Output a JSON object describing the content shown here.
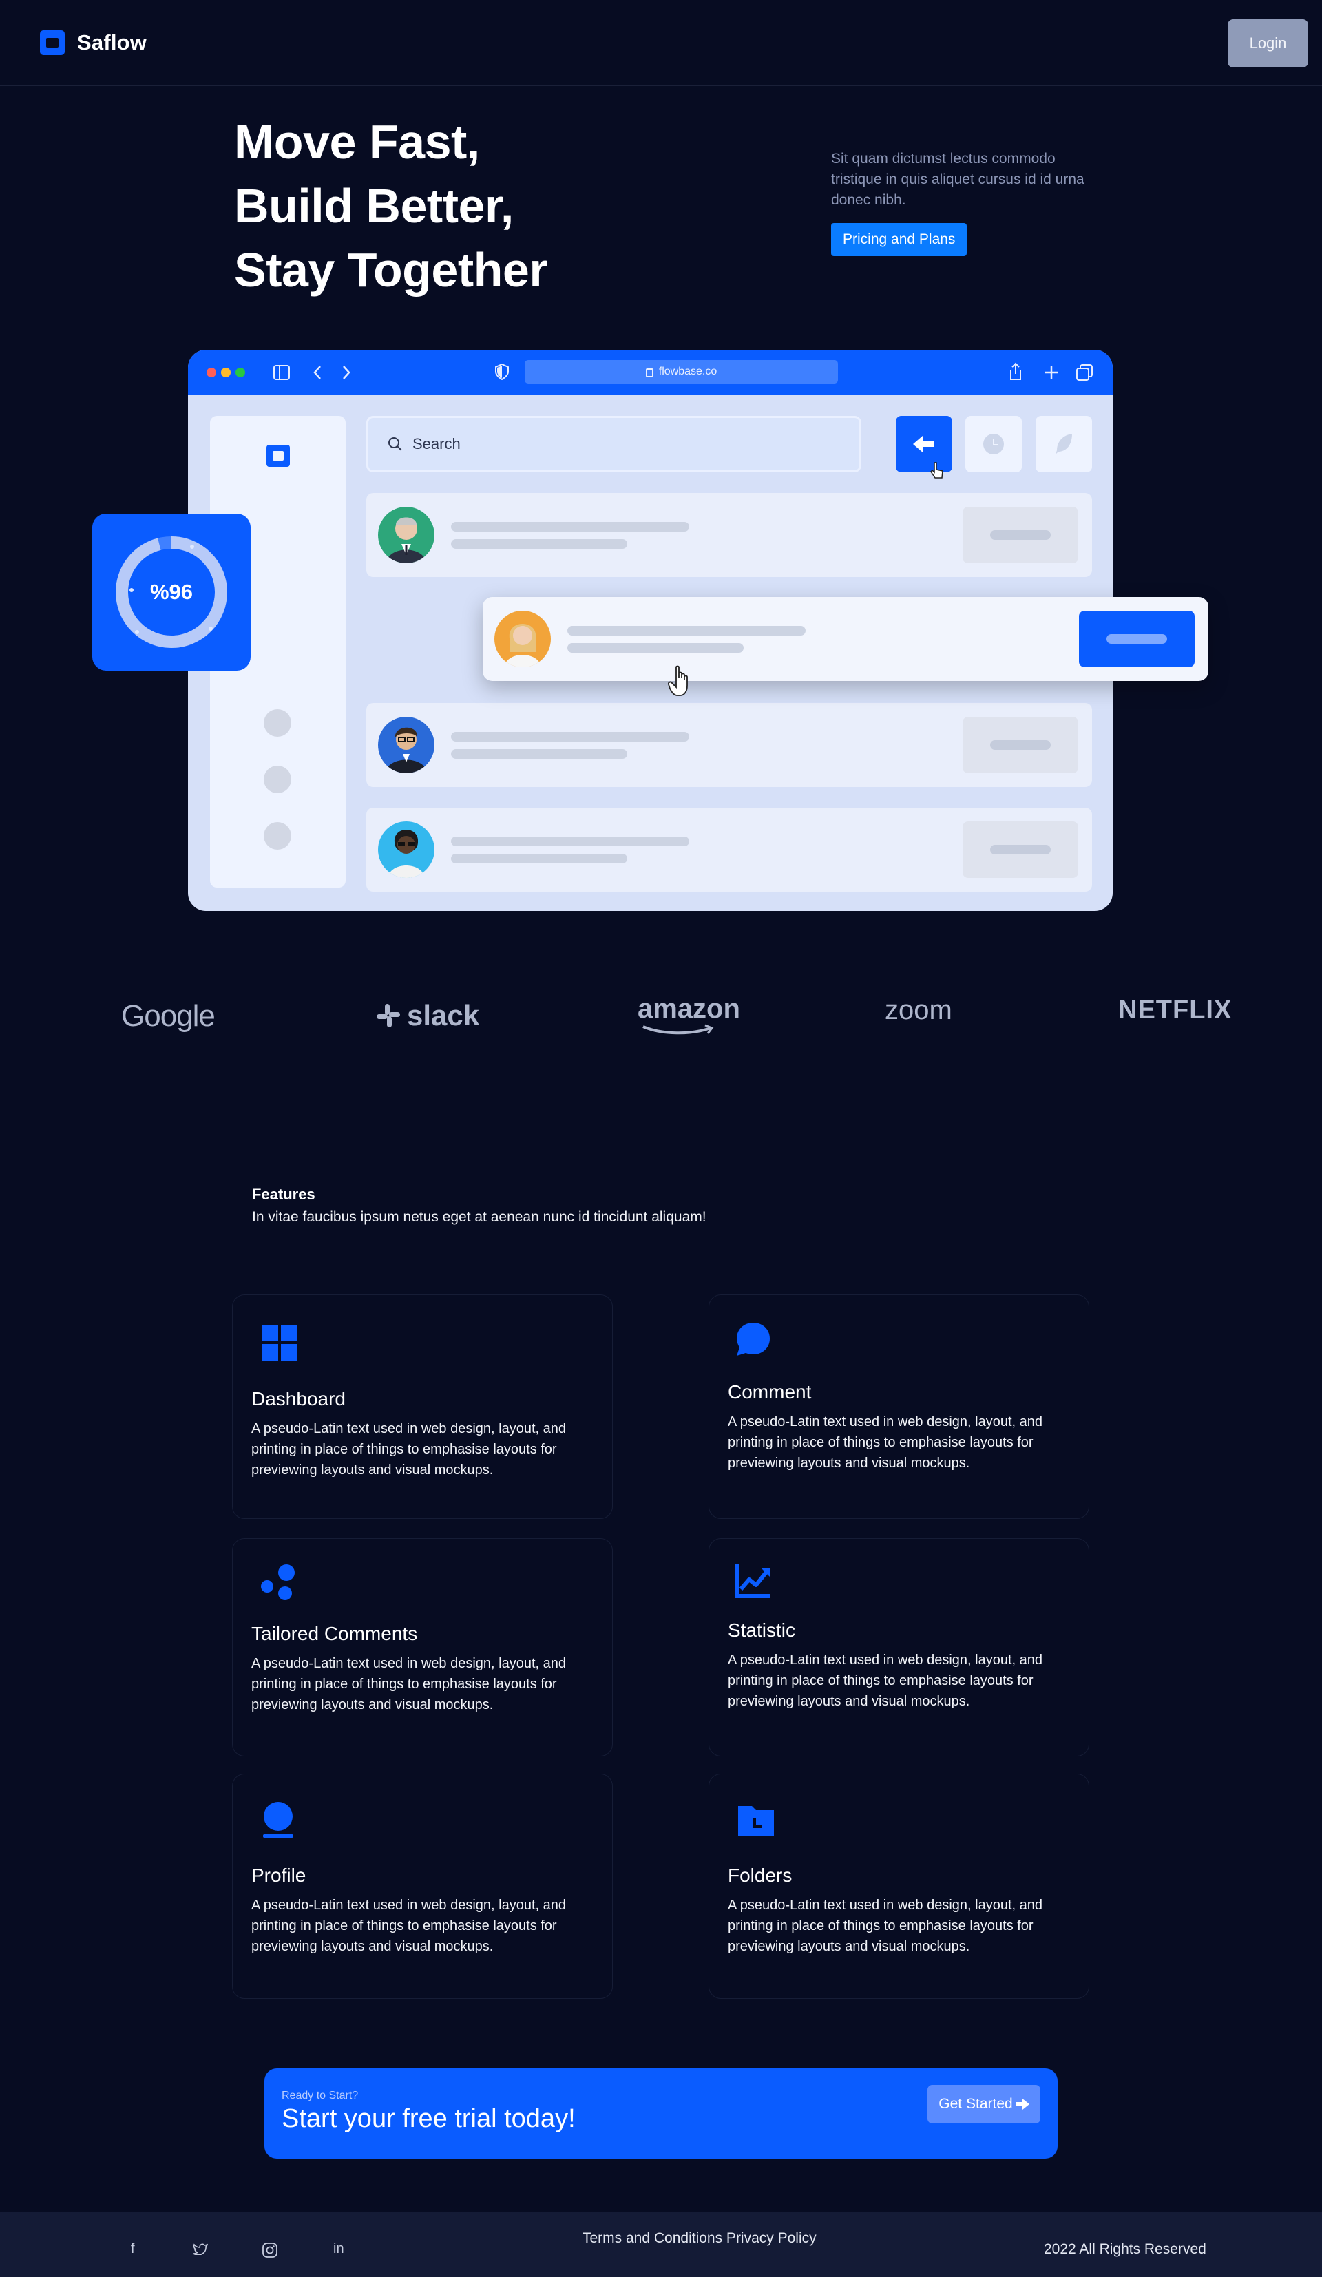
{
  "brand": {
    "name": "Saflow"
  },
  "header": {
    "login_label": "Login"
  },
  "hero": {
    "title_lines": [
      "Move Fast,",
      "Build Better,",
      "Stay Together"
    ],
    "description": "Sit quam dictumst lectus commodo tristique in quis aliquet cursus id id urna donec nibh.",
    "pricing_label": "Pricing and Plans"
  },
  "mockup": {
    "url": "flowbase.co",
    "search_placeholder": "Search",
    "gauge_value": "%96",
    "gauge_fraction": 0.96
  },
  "logos": [
    "Google",
    "slack",
    "amazon",
    "zoom",
    "NETFLIX"
  ],
  "features": {
    "title": "Features",
    "subtitle": "In vitae faucibus ipsum netus eget at aenean nunc id tincidunt aliquam!",
    "cards": [
      {
        "title": "Dashboard",
        "icon": "dashboard-grid-icon",
        "desc": "A pseudo-Latin text used in web design, layout, and printing in place of things to emphasise layouts for previewing layouts and visual mockups."
      },
      {
        "title": "Comment",
        "icon": "comment-bubble-icon",
        "desc": "A pseudo-Latin text used in web design, layout, and printing in place of things to emphasise layouts for previewing layouts and visual mockups."
      },
      {
        "title": "Tailored Comments",
        "icon": "bubbles-icon",
        "desc": "A pseudo-Latin text used in web design, layout, and printing in place of things to emphasise layouts for previewing layouts and visual mockups."
      },
      {
        "title": "Statistic",
        "icon": "line-chart-icon",
        "desc": "A pseudo-Latin text used in web design, layout, and printing in place of things to emphasise layouts for previewing layouts and visual mockups."
      },
      {
        "title": "Profile",
        "icon": "user-profile-icon",
        "desc": "A pseudo-Latin text used in web design, layout, and printing in place of things to emphasise layouts for previewing layouts and visual mockups."
      },
      {
        "title": "Folders",
        "icon": "folder-icon",
        "desc": "A pseudo-Latin text used in web design, layout, and printing in place of things to emphasise layouts for previewing layouts and visual mockups."
      }
    ]
  },
  "cta": {
    "eyebrow": "Ready to Start?",
    "headline": "Start your free trial today!",
    "button_label": "Get Started"
  },
  "footer": {
    "social": [
      "f",
      "twitter",
      "instagram",
      "in"
    ],
    "links": "Terms and Conditions Privacy Policy",
    "copyright": "2022 All Rights Reserved"
  },
  "colors": {
    "background": "#070c22",
    "accent": "#0a5cff",
    "footer": "#141b36"
  }
}
